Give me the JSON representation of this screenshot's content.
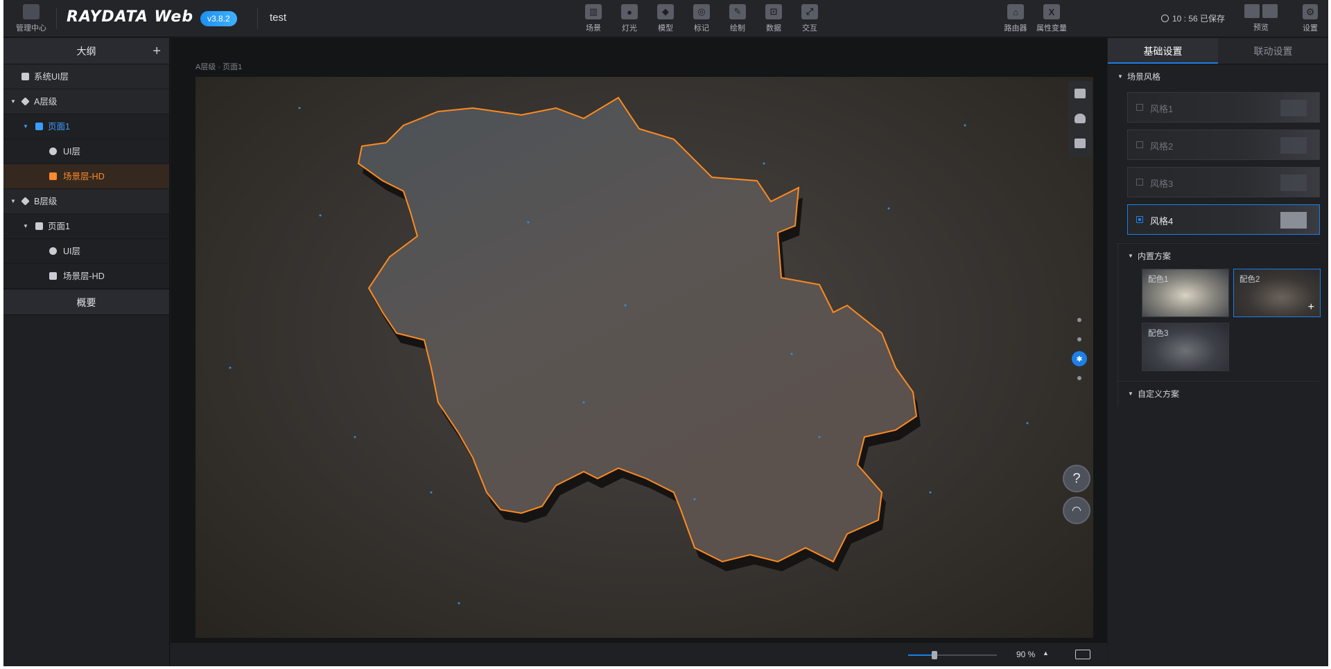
{
  "topbar": {
    "home_label": "管理中心",
    "logo": "RAYDATA Web",
    "version": "v3.8.2",
    "project_name": "test",
    "tools": [
      {
        "label": "场景",
        "icon": "scene-icon"
      },
      {
        "label": "灯光",
        "icon": "light-icon"
      },
      {
        "label": "模型",
        "icon": "model-icon"
      },
      {
        "label": "标记",
        "icon": "marker-icon"
      },
      {
        "label": "绘制",
        "icon": "draw-icon"
      },
      {
        "label": "数据",
        "icon": "data-icon"
      },
      {
        "label": "交互",
        "icon": "interaction-icon"
      }
    ],
    "right_tools": [
      {
        "label": "路由器",
        "icon": "router-icon"
      },
      {
        "label": "属性变量",
        "icon": "variable-icon"
      }
    ],
    "save_status": "10 : 56 已保存",
    "preview_label": "预览",
    "settings_label": "设置"
  },
  "outline": {
    "title": "大纲",
    "system_ui_layer": "系统UI层",
    "layers": [
      {
        "name": "A层级",
        "pages": [
          {
            "name": "页面1",
            "children": [
              "UI层",
              "场景层-HD"
            ]
          }
        ]
      },
      {
        "name": "B层级",
        "pages": [
          {
            "name": "页面1",
            "children": [
              "UI层",
              "场景层-HD"
            ]
          }
        ]
      }
    ],
    "summary_title": "概要"
  },
  "canvas": {
    "breadcrumb": "A层级 · 页面1",
    "help_symbol": "?",
    "zoom_value": "90 %",
    "zoom_level": 0.3
  },
  "settings": {
    "tabs": [
      "基础设置",
      "联动设置"
    ],
    "scene_style_title": "场景风格",
    "styles": [
      "风格1",
      "风格2",
      "风格3",
      "风格4"
    ],
    "selected_style": "风格4",
    "builtin_title": "内置方案",
    "color_schemes": [
      "配色1",
      "配色2",
      "配色3"
    ],
    "selected_scheme": "配色2",
    "custom_title": "自定义方案"
  },
  "colors": {
    "accent": "#1d7fe8",
    "selection": "#ff8a2b",
    "map_outline": "#ff8a1f"
  }
}
